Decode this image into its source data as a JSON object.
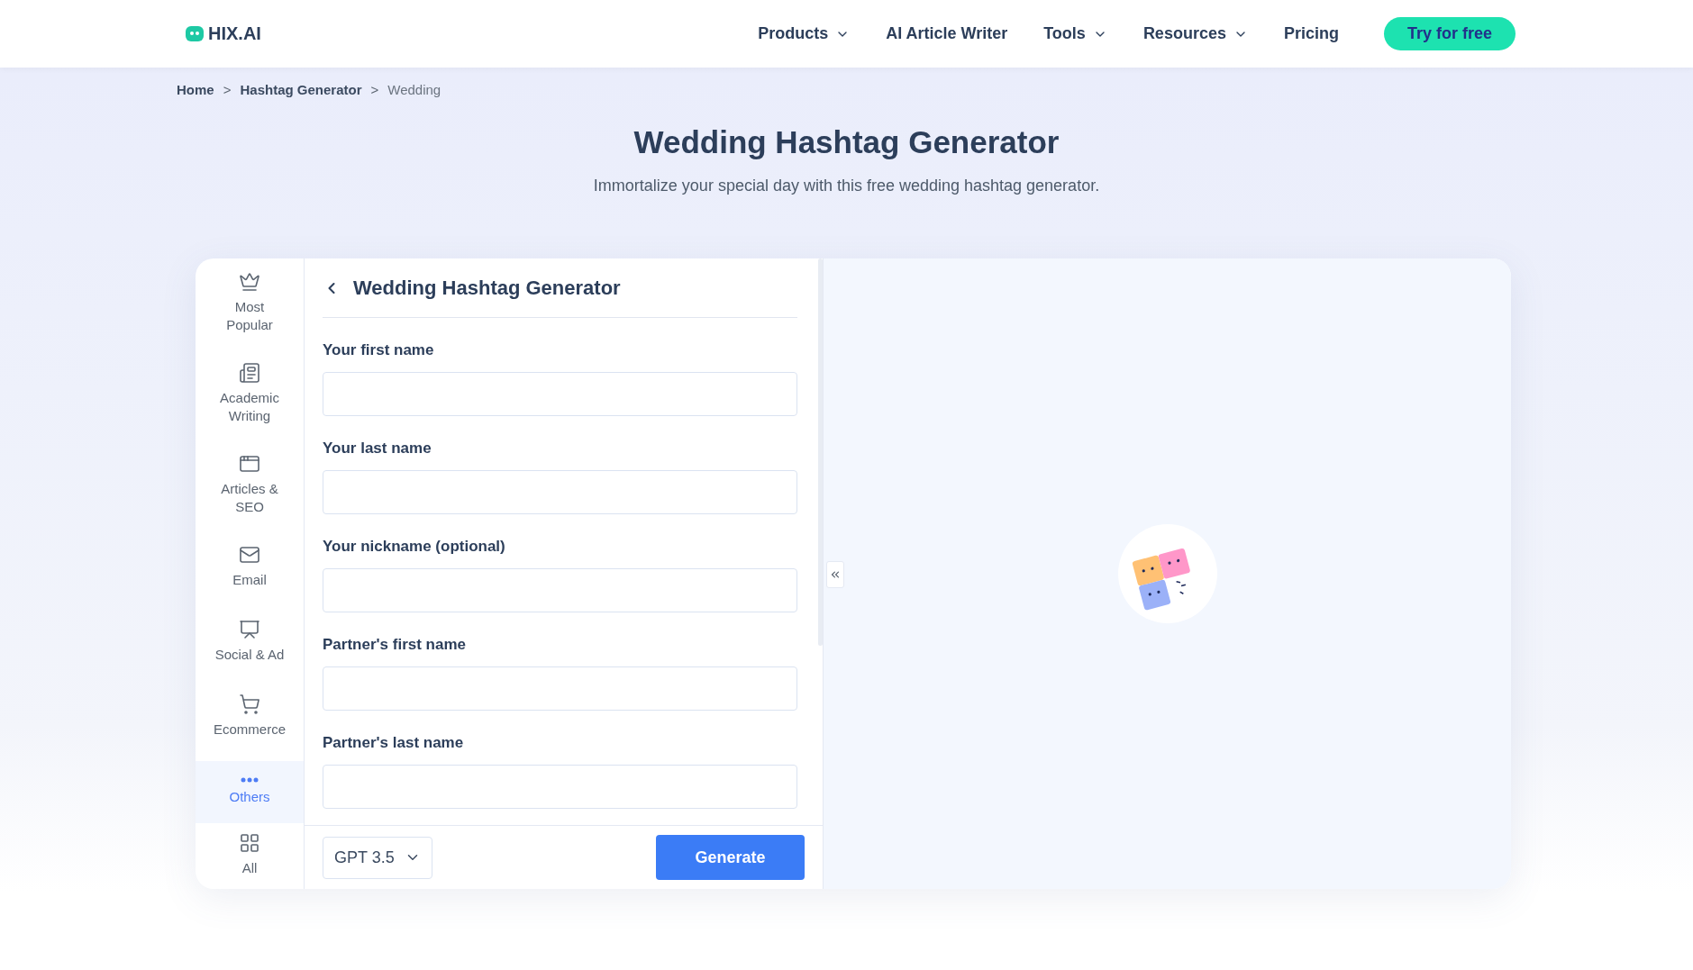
{
  "header": {
    "logo": "HIX.AI",
    "nav": [
      {
        "label": "Products",
        "dropdown": true
      },
      {
        "label": "AI Article Writer",
        "dropdown": false
      },
      {
        "label": "Tools",
        "dropdown": true
      },
      {
        "label": "Resources",
        "dropdown": true
      },
      {
        "label": "Pricing",
        "dropdown": false
      }
    ],
    "cta": "Try for free"
  },
  "breadcrumb": [
    {
      "label": "Home",
      "current": false
    },
    {
      "label": "Hashtag Generator",
      "current": false
    },
    {
      "label": "Wedding",
      "current": true
    }
  ],
  "breadcrumb_separator": ">",
  "hero": {
    "title": "Wedding Hashtag Generator",
    "subtitle": "Immortalize your special day with this free wedding hashtag generator."
  },
  "sidebar": {
    "items": [
      {
        "kind": "crown",
        "label": "Most Popular",
        "selected": false
      },
      {
        "kind": "academic",
        "label": "Academic Writing",
        "selected": false
      },
      {
        "kind": "articles",
        "label": "Articles & SEO",
        "selected": false
      },
      {
        "kind": "email",
        "label": "Email",
        "selected": false
      },
      {
        "kind": "social",
        "label": "Social & Ad",
        "selected": false
      },
      {
        "kind": "cart",
        "label": "Ecommerce",
        "selected": false
      },
      {
        "kind": "dots",
        "label": "Others",
        "selected": true
      },
      {
        "kind": "grid",
        "label": "All",
        "selected": false
      }
    ]
  },
  "form": {
    "title": "Wedding Hashtag Generator",
    "fields": [
      {
        "label": "Your first name"
      },
      {
        "label": "Your last name"
      },
      {
        "label": "Your nickname (optional)"
      },
      {
        "label": "Partner's first name"
      },
      {
        "label": "Partner's last name"
      }
    ],
    "model": "GPT 3.5",
    "submit": "Generate"
  }
}
